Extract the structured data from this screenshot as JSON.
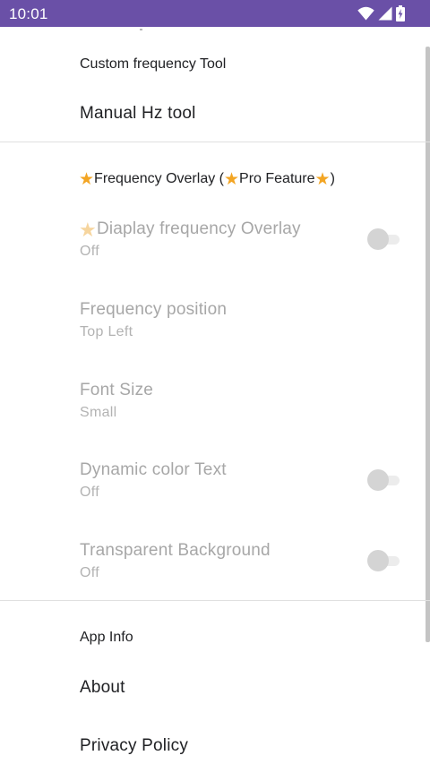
{
  "status_bar": {
    "time": "10:01",
    "icons": [
      "wifi-icon",
      "signal-icon",
      "battery-charging-icon"
    ],
    "color": "#6a50a7"
  },
  "custom_frequency_section": {
    "header": "Custom frequency Tool",
    "manual_hz_tool": "Manual Hz tool"
  },
  "overlay_section": {
    "header_prefix": "Frequency Overlay (",
    "header_pro": "Pro Feature",
    "header_suffix": ")",
    "display_overlay": {
      "title": "Diaplay frequency Overlay",
      "summary": "Off",
      "enabled": false
    },
    "frequency_position": {
      "title": "Frequency position",
      "summary": "Top Left"
    },
    "font_size": {
      "title": "Font Size",
      "summary": "Small"
    },
    "dynamic_color_text": {
      "title": "Dynamic color Text",
      "summary": "Off",
      "enabled": false
    },
    "transparent_background": {
      "title": "Transparent Background",
      "summary": "Off",
      "enabled": false
    },
    "star_color": "#f3a523"
  },
  "app_info_section": {
    "header": "App Info",
    "about": "About",
    "privacy_policy": "Privacy Policy"
  }
}
